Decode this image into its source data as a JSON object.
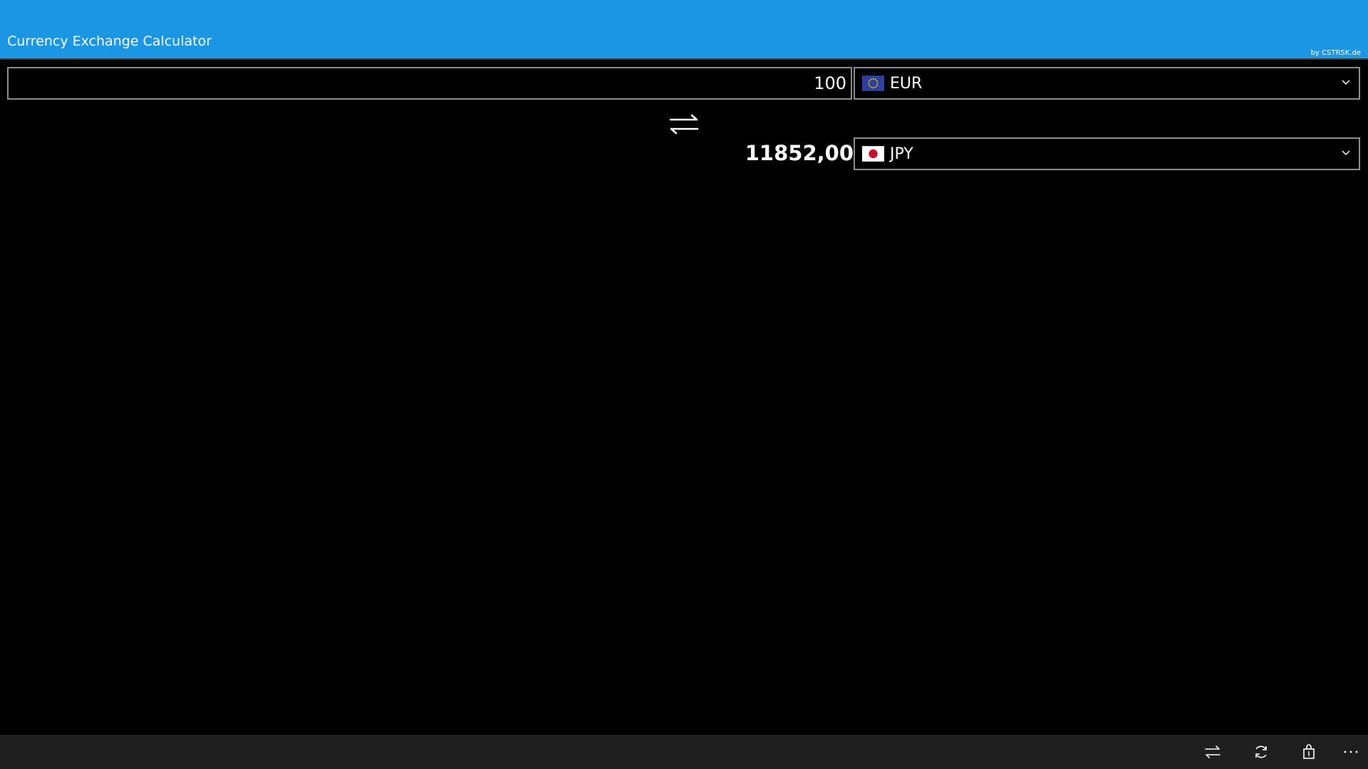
{
  "header": {
    "title": "Currency Exchange Calculator",
    "credit": "by CSTRSK.de",
    "background_color": "#1a96e2"
  },
  "converter": {
    "amount": "100",
    "from_currency": {
      "code": "EUR",
      "flag": "eu-flag-icon"
    },
    "to_currency": {
      "code": "JPY",
      "flag": "japan-flag-icon"
    },
    "result": "11852,00",
    "swap_icon": "swap-arrows-icon"
  },
  "appbar": {
    "background_color": "#1f1f1f",
    "icons": [
      "swap-arrows-icon",
      "refresh-icon",
      "store-bag-icon",
      "more-icon"
    ]
  }
}
